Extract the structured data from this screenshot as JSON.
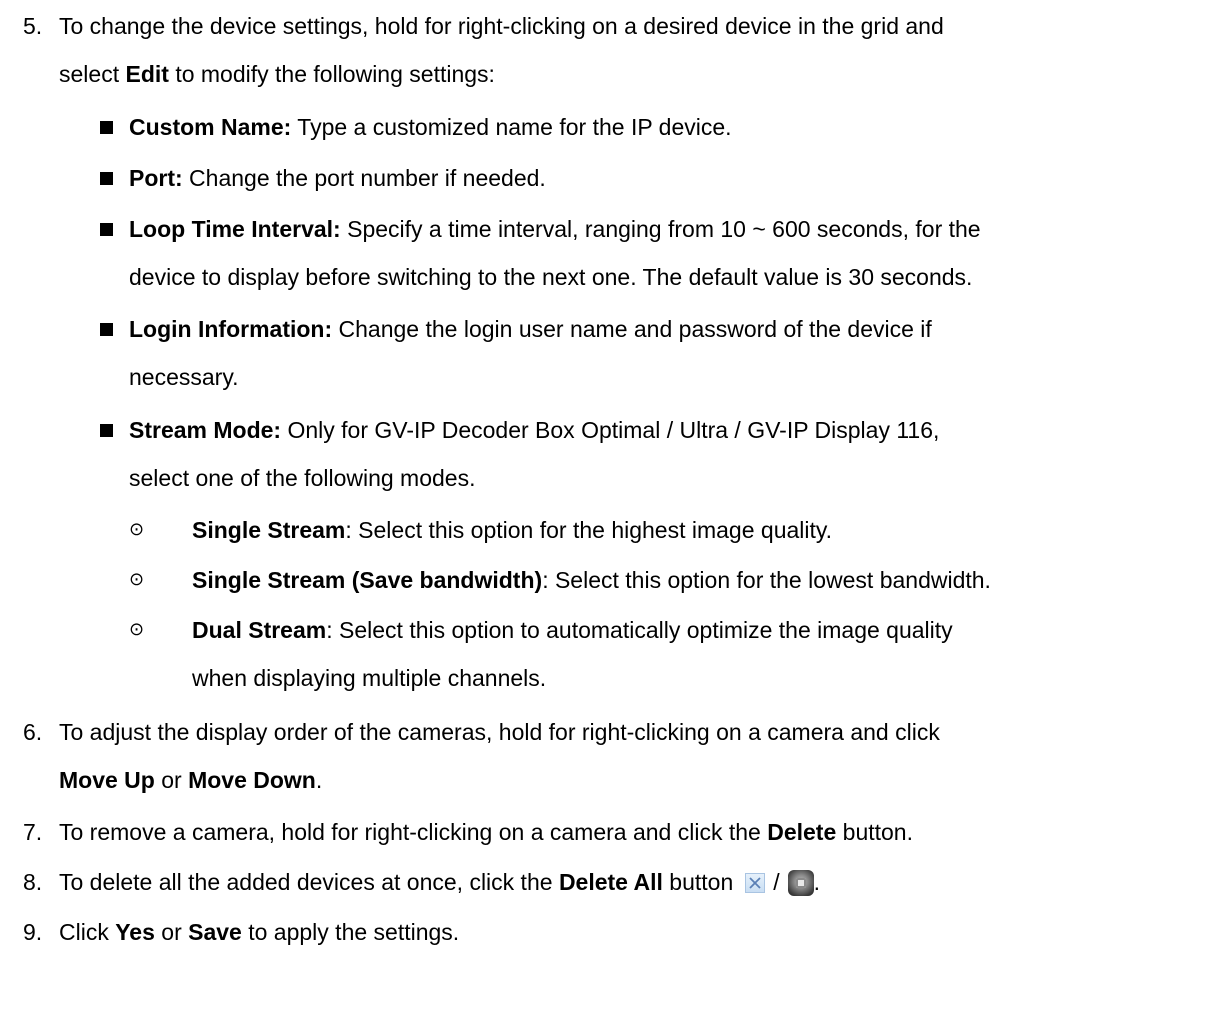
{
  "steps": {
    "s5": {
      "num": "5.",
      "l1": "To change the device settings, hold for right-clicking on a desired device in the grid and",
      "l2_pre": "select ",
      "l2_bold": "Edit",
      "l2_post": " to modify the following settings:"
    },
    "bullets": [
      {
        "term": "Custom Name:",
        "text": " Type a customized name for the IP device."
      },
      {
        "term": "Port:",
        "text": " Change the port number if needed."
      },
      {
        "term": "Loop Time Interval:",
        "text": " Specify a time interval, ranging from 10 ~ 600 seconds, for the",
        "cont": "device to display before switching to the next one. The default value is 30 seconds."
      },
      {
        "term": "Login Information:",
        "text": " Change the login user name and password of the device if",
        "cont": "necessary."
      },
      {
        "term": "Stream Mode:",
        "text": " Only for GV-IP Decoder Box Optimal / Ultra / GV-IP Display 116,",
        "cont": "select one of the following modes."
      }
    ],
    "modes": [
      {
        "symbol": "⊙",
        "term": "Single Stream",
        "text": ": Select this option for the highest image quality."
      },
      {
        "symbol": "⊙",
        "term": "Single Stream (Save bandwidth)",
        "text": ": Select this option for the lowest bandwidth."
      },
      {
        "symbol": "⊙",
        "term": "Dual Stream",
        "text": ": Select this option to automatically optimize the image quality",
        "cont": "when displaying multiple channels."
      }
    ],
    "s6": {
      "num": "6.",
      "l1": "To adjust the display order of the cameras, hold for right-clicking on a camera and click",
      "b1": "Move Up",
      "mid": " or ",
      "b2": "Move Down",
      "end": "."
    },
    "s7": {
      "num": "7.",
      "pre": "To remove a camera, hold for right-clicking on a camera and click the ",
      "bold": "Delete",
      "post": " button."
    },
    "s8": {
      "num": "8.",
      "pre": "To delete all the added devices at once, click the ",
      "bold": "Delete All",
      "post": " button",
      "sep": "/",
      "end": ".",
      "icon1": "delete-all-x-icon",
      "icon2": "delete-all-round-icon"
    },
    "s9": {
      "num": "9.",
      "pre": "Click ",
      "b1": "Yes",
      "mid": " or ",
      "b2": "Save",
      "post": " to apply the settings."
    }
  }
}
